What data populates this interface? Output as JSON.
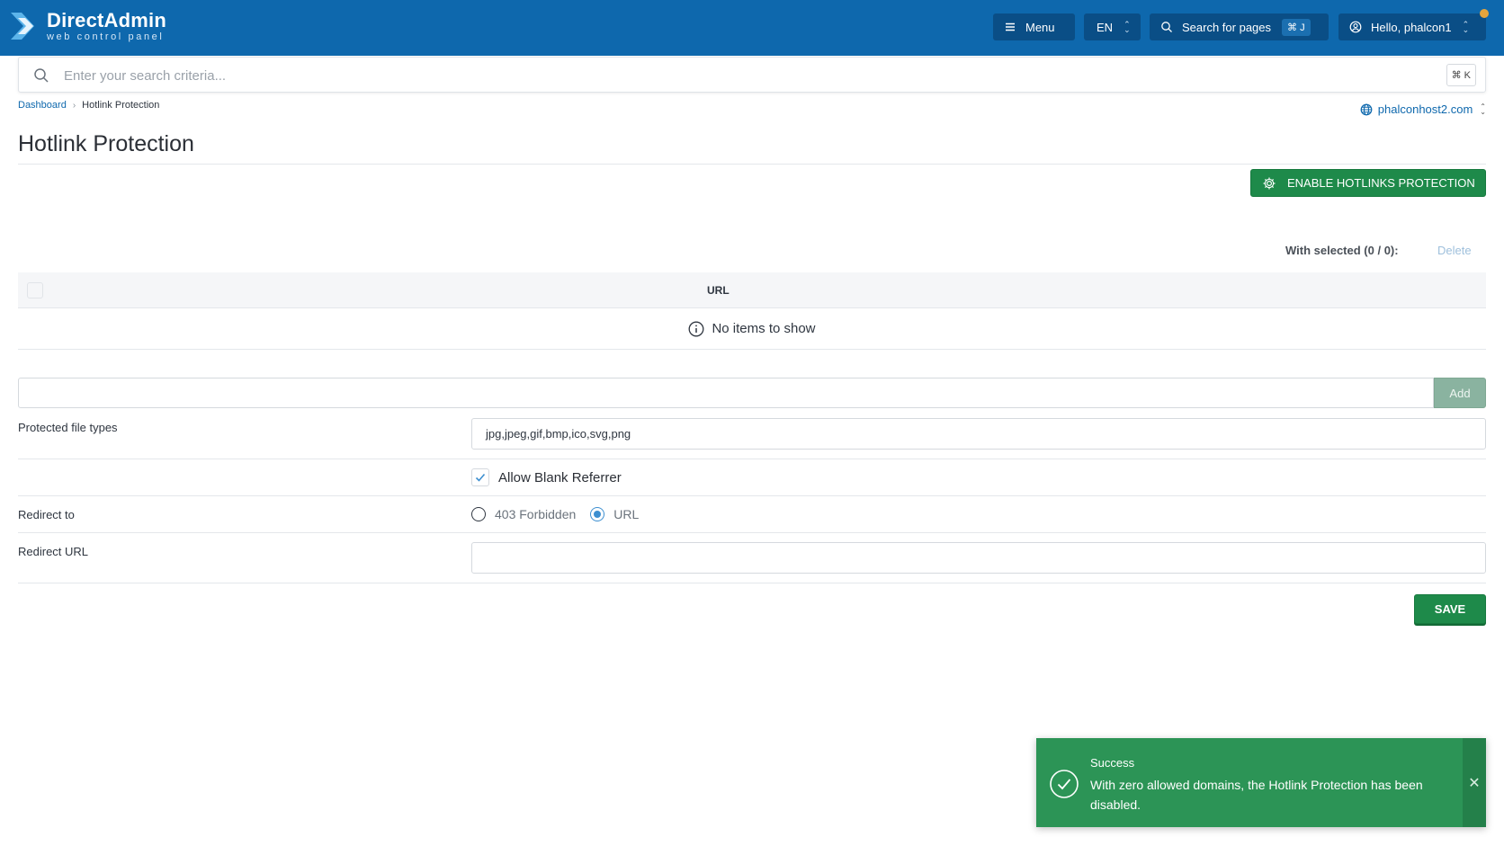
{
  "header": {
    "logo_title": "DirectAdmin",
    "logo_subtitle": "web control panel",
    "menu_label": "Menu",
    "language": "EN",
    "search_pages_label": "Search for pages",
    "search_pages_shortcut": "⌘ J",
    "user_label": "Hello, phalcon1",
    "accent_color": "#0e68ad"
  },
  "search": {
    "placeholder": "Enter your search criteria...",
    "shortcut": "⌘ K"
  },
  "breadcrumb": {
    "items": [
      "Dashboard",
      "Hotlink Protection"
    ]
  },
  "domain_selector": {
    "value": "phalconhost2.com"
  },
  "page": {
    "title": "Hotlink Protection",
    "enable_button": "ENABLE HOTLINKS PROTECTION",
    "with_selected": "With selected (0 / 0):",
    "delete_label": "Delete"
  },
  "table": {
    "columns": [
      "URL"
    ],
    "rows": [],
    "empty_message": "No items to show"
  },
  "form": {
    "add_url_value": "",
    "add_button": "Add",
    "protected_types_label": "Protected file types",
    "protected_types_value": "jpg,jpeg,gif,bmp,ico,svg,png",
    "allow_blank_label": "Allow Blank Referrer",
    "allow_blank_checked": true,
    "redirect_to_label": "Redirect to",
    "redirect_options": [
      "403 Forbidden",
      "URL"
    ],
    "redirect_selected": "URL",
    "redirect_url_label": "Redirect URL",
    "redirect_url_value": "",
    "save_button": "SAVE"
  },
  "toast": {
    "title": "Success",
    "message": "With zero allowed domains, the Hotlink Protection has been disabled.",
    "color": "#2c9456"
  }
}
